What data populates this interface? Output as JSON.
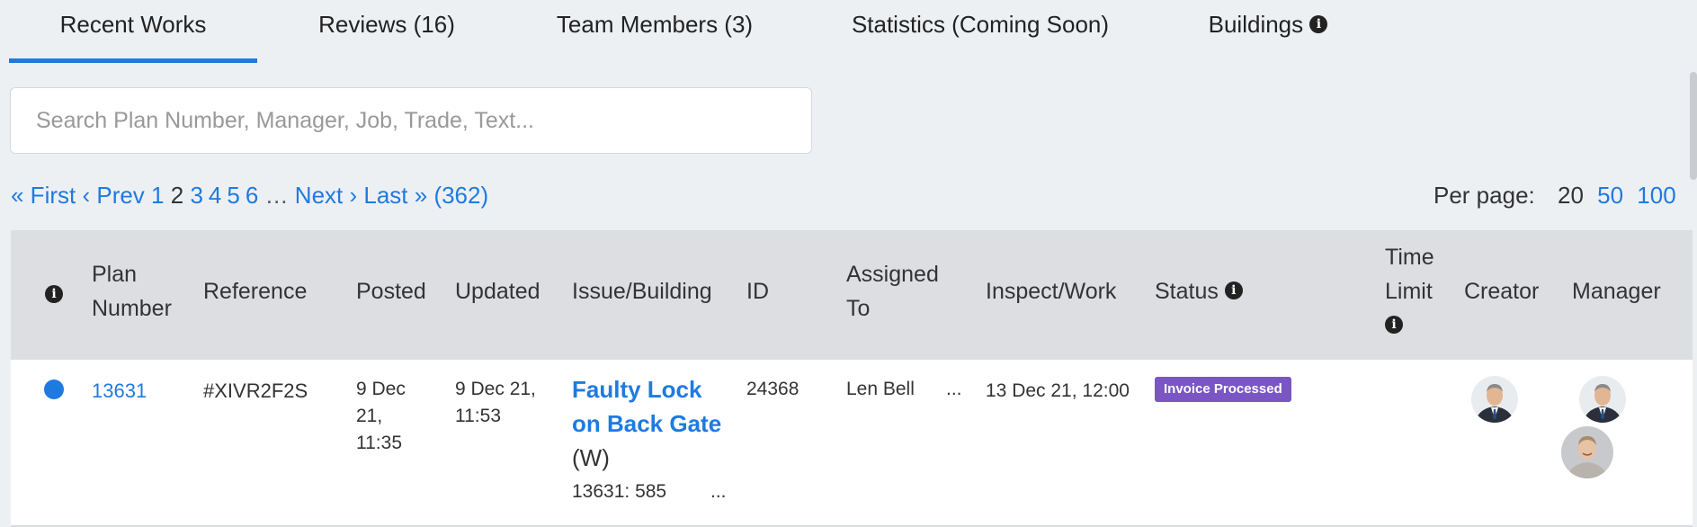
{
  "tabs": [
    {
      "label": "Recent Works"
    },
    {
      "label": "Reviews (16)"
    },
    {
      "label": "Team Members (3)"
    },
    {
      "label": "Statistics (Coming Soon)"
    },
    {
      "label": "Buildings"
    }
  ],
  "search": {
    "placeholder": "Search Plan Number, Manager, Job, Trade, Text..."
  },
  "pager": {
    "first": "« First",
    "prev": "‹ Prev",
    "pages": [
      "1",
      "2",
      "3",
      "4",
      "5",
      "6"
    ],
    "current": "2",
    "ellipsis": "…",
    "next": "Next ›",
    "last": "Last »",
    "total": "(362)"
  },
  "per_page": {
    "label": "Per page:",
    "current": "20",
    "opt_50": "50",
    "opt_100": "100"
  },
  "table": {
    "headers": {
      "plan_number": "Plan Number",
      "reference": "Reference",
      "posted": "Posted",
      "updated": "Updated",
      "issue_building": "Issue/Building",
      "id": "ID",
      "assigned_to": "Assigned To",
      "inspect_work": "Inspect/Work",
      "status": "Status",
      "time_limit": "Time Limit",
      "creator": "Creator",
      "manager": "Manager"
    },
    "rows": [
      {
        "plan_number": "13631",
        "reference": "#XIVR2F2S",
        "posted": "9 Dec 21, 11:35",
        "updated": "9 Dec 21, 11:53",
        "issue_title": "Faulty Lock on Back Gate",
        "issue_type": "(W)",
        "building": "13631: 585",
        "building_more": "...",
        "id": "24368",
        "assigned_to": "Len Bell",
        "assigned_more": "...",
        "inspect_work": "13 Dec 21, 12:00",
        "status": "Invoice Processed",
        "time_limit": ""
      }
    ]
  },
  "colors": {
    "accent": "#1f7ae0",
    "badge": "#7a55c4",
    "header_bg": "#dcdee2",
    "page_bg": "#edf0f3"
  },
  "icons": [
    "info-icon",
    "unread-dot-icon",
    "avatar"
  ]
}
